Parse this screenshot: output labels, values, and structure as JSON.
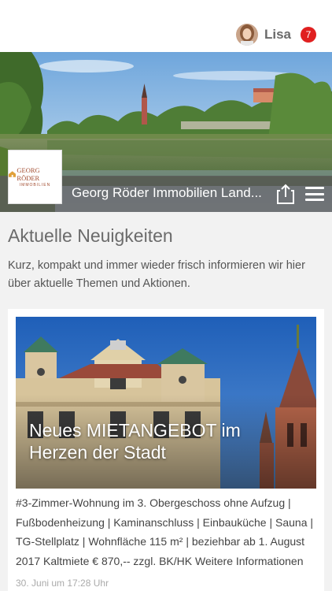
{
  "header": {
    "username": "Lisa",
    "notification_count": "7"
  },
  "hero": {
    "company_title": "Georg Röder Immobilien Land...",
    "logo": {
      "line1": "GEORG RÖDER",
      "line2": "IMMOBILIEN"
    }
  },
  "section": {
    "title": "Aktuelle Neuigkeiten",
    "description": "Kurz, kompakt und immer wieder frisch informieren wir hier über aktuelle Themen und Aktionen."
  },
  "news": [
    {
      "headline": "Neues MIETANGEBOT im Herzen der Stadt",
      "text": "#3-Zimmer-Wohnung im 3. Obergeschoss ohne Aufzug | Fußbodenheizung | Kaminanschluss | Einbauküche | Sauna | TG-Stellplatz | Wohnfläche 115 m² | beziehbar ab 1. August 2017 Kaltmiete € 870,-- zzgl. BK/HK Weitere Informationen",
      "date": "30. Juni um 17:28 Uhr"
    }
  ],
  "colors": {
    "badge": "#e02020",
    "title_bar": "#5a5a5a",
    "logo_brand": "#a0492c"
  }
}
